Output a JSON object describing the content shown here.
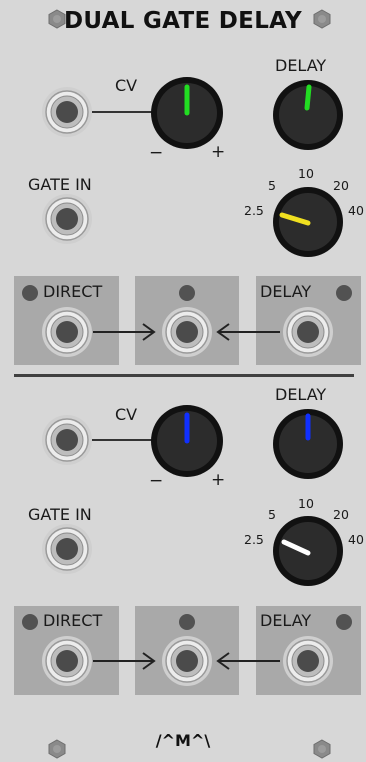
{
  "module": {
    "title": "DUAL GATE DELAY",
    "logo": "/^M^\\"
  },
  "sections": [
    {
      "cv_label": "CV",
      "minus": "−",
      "plus": "+",
      "delay_label": "DELAY",
      "gate_in_label": "GATE IN",
      "range_ticks": [
        "5",
        "10",
        "20",
        "2.5",
        "40"
      ],
      "direct_label": "DIRECT",
      "delay_out_label": "DELAY",
      "cv_knob_color": "#22dd22",
      "delay_knob_color": "#22dd22",
      "range_knob_color": "#f0e020"
    },
    {
      "cv_label": "CV",
      "minus": "−",
      "plus": "+",
      "delay_label": "DELAY",
      "gate_in_label": "GATE IN",
      "range_ticks": [
        "5",
        "10",
        "20",
        "2.5",
        "40"
      ],
      "direct_label": "DIRECT",
      "delay_out_label": "DELAY",
      "cv_knob_color": "#1030ff",
      "delay_knob_color": "#1030ff",
      "range_knob_color": "#ffffff"
    }
  ]
}
